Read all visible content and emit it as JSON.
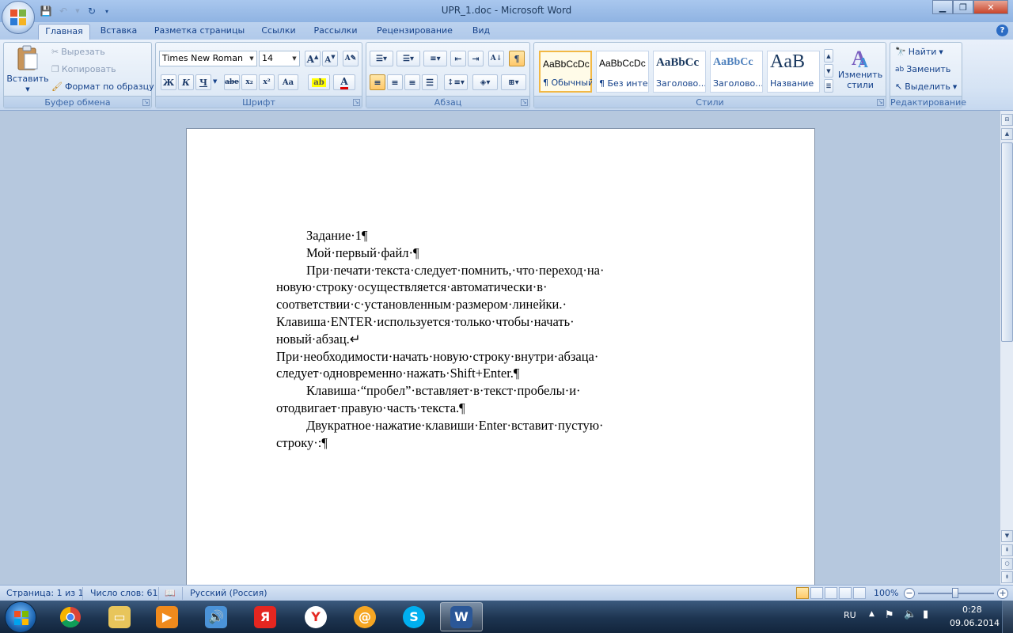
{
  "window": {
    "title": "UPR_1.doc - Microsoft Word"
  },
  "tabs": [
    "Главная",
    "Вставка",
    "Разметка страницы",
    "Ссылки",
    "Рассылки",
    "Рецензирование",
    "Вид"
  ],
  "active_tab": "Главная",
  "ribbon": {
    "clipboard": {
      "label": "Буфер обмена",
      "paste": "Вставить",
      "cut": "Вырезать",
      "copy": "Копировать",
      "format_painter": "Формат по образцу"
    },
    "font": {
      "label": "Шрифт",
      "font_name": "Times New Roman",
      "font_size": "14",
      "bold": "Ж",
      "italic": "К",
      "underline": "Ч",
      "strike": "abe",
      "subscript": "x₂",
      "superscript": "x²",
      "change_case": "Aa"
    },
    "paragraph": {
      "label": "Абзац"
    },
    "styles": {
      "label": "Стили",
      "items": [
        {
          "sample": "AaBbCcDc",
          "name": "¶ Обычный"
        },
        {
          "sample": "AaBbCcDc",
          "name": "¶ Без инте..."
        },
        {
          "sample": "AaBbCc",
          "name": "Заголово..."
        },
        {
          "sample": "AaBbCc",
          "name": "Заголово..."
        },
        {
          "sample": "AaB",
          "name": "Название"
        }
      ],
      "change_styles_line1": "Изменить",
      "change_styles_line2": "стили"
    },
    "editing": {
      "label": "Редактирование",
      "find": "Найти",
      "replace": "Заменить",
      "select": "Выделить"
    }
  },
  "document": {
    "lines": [
      {
        "text": "Задание·1¶",
        "indent": true
      },
      {
        "text": "Мой·первый·файл·¶",
        "indent": true
      },
      {
        "text": "При·печати·текста·следует·помнить,·что·переход·на·",
        "indent": true
      },
      {
        "text": "новую·строку·осуществляется·автоматически·в·",
        "indent": false
      },
      {
        "text": "соответствии·с·установленным·размером·линейки.·",
        "indent": false
      },
      {
        "text": "Клавиша·ENTER·используется·только·чтобы·начать·",
        "indent": false
      },
      {
        "text": "новый·абзац.↵",
        "indent": false
      },
      {
        "text": "При·необходимости·начать·новую·строку·внутри·абзаца·",
        "indent": false
      },
      {
        "text": "следует·одновременно·нажать·Shift+Enter.¶",
        "indent": false
      },
      {
        "text": "Клавиша·“пробел”·вставляет·в·текст·пробелы·и·",
        "indent": true
      },
      {
        "text": "отодвигает·правую·часть·текста.¶",
        "indent": false
      },
      {
        "text": "Двукратное·нажатие·клавиши·Enter·вставит·пустую·",
        "indent": true
      },
      {
        "text": "строку·:¶",
        "indent": false
      }
    ]
  },
  "statusbar": {
    "page": "Страница: 1 из 1",
    "words": "Число слов: 61",
    "language": "Русский (Россия)",
    "zoom": "100%"
  },
  "taskbar": {
    "lang": "RU",
    "time": "0:28",
    "date": "09.06.2014"
  },
  "colors": {
    "accent": "#15428b",
    "ribbon_bg": "#dae6f4"
  }
}
